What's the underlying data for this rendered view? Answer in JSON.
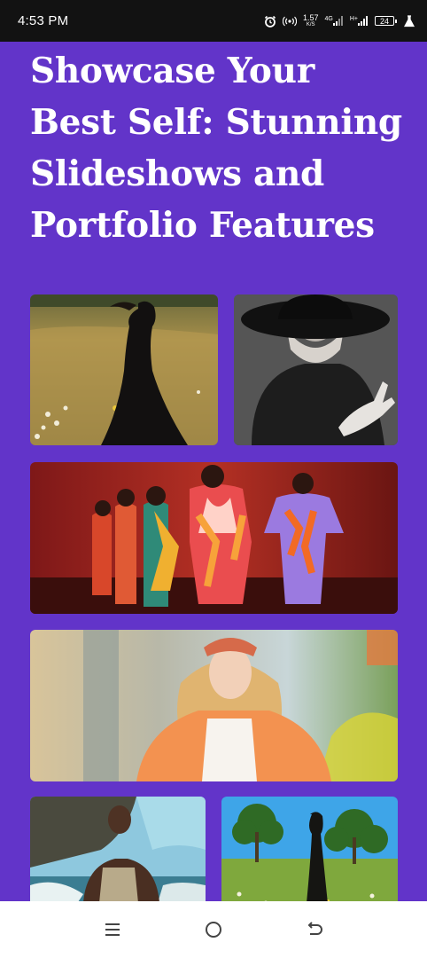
{
  "status_bar": {
    "time": "4:53 PM",
    "net_speed_value": "1.57",
    "net_speed_unit": "K/S",
    "network_4g": "4G",
    "network_h": "H+",
    "battery_level": "24",
    "icons": [
      "alarm-icon",
      "hotspot-icon",
      "signal-icon",
      "battery-icon",
      "lab-flask-icon"
    ]
  },
  "page": {
    "headline": "Showcase Your Best Self: Stunning Slideshows and Portfolio Features",
    "background_color": "#6234c9"
  },
  "gallery": {
    "photos": [
      {
        "name": "gallery-photo-woman-field"
      },
      {
        "name": "gallery-photo-woman-hat"
      },
      {
        "name": "gallery-photo-runway"
      },
      {
        "name": "gallery-photo-woman-orange-jacket"
      },
      {
        "name": "gallery-photo-man-beach"
      },
      {
        "name": "gallery-photo-woman-meadow"
      }
    ]
  },
  "nav_bar": {
    "icons": [
      "menu-icon",
      "home-icon",
      "back-icon"
    ]
  }
}
